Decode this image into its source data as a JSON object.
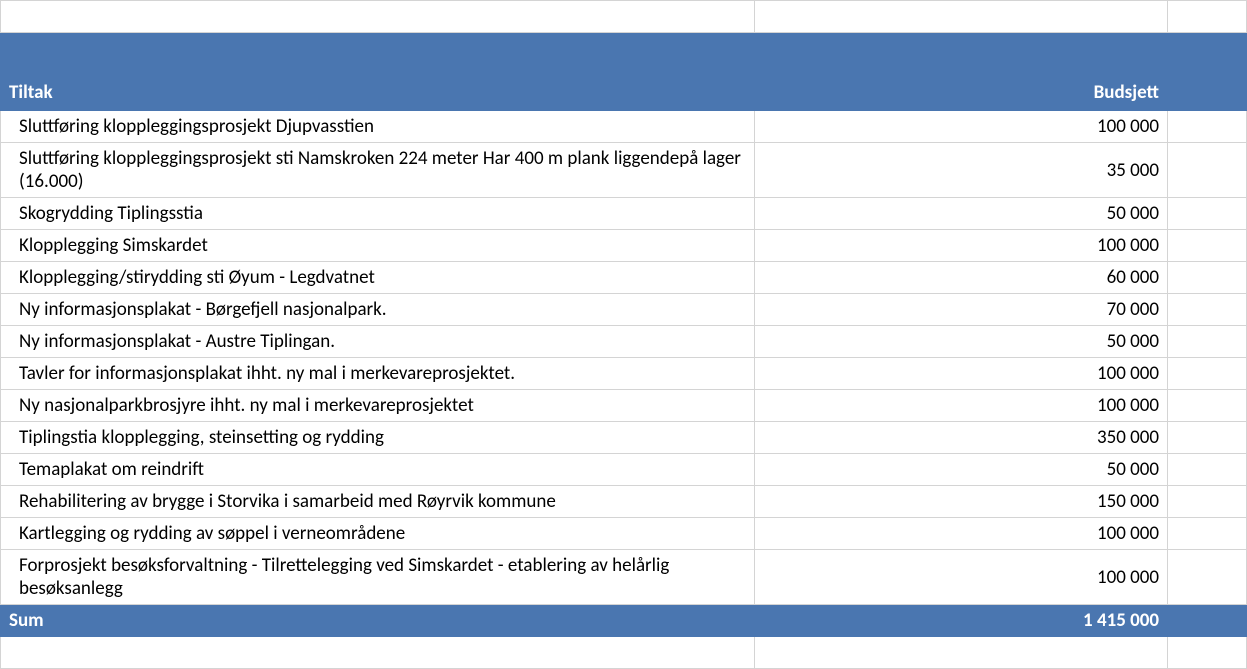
{
  "chart_data": {
    "type": "table",
    "title": "",
    "columns": [
      "Tiltak",
      "Budsjett"
    ],
    "rows": [
      [
        "Sluttføring kloppleggingsprosjekt Djupvasstien",
        100000
      ],
      [
        "Sluttføring kloppleggingsprosjekt sti Namskroken 224 meter Har 400 m plank liggendepå lager (16.000)",
        35000
      ],
      [
        "Skogrydding Tiplingsstia",
        50000
      ],
      [
        "Klopplegging Simskardet",
        100000
      ],
      [
        "Klopplegging/stirydding sti Øyum - Legdvatnet",
        60000
      ],
      [
        "Ny informasjonsplakat - Børgefjell nasjonalpark.",
        70000
      ],
      [
        "Ny informasjonsplakat - Austre Tiplingan.",
        50000
      ],
      [
        "Tavler for informasjonsplakat ihht. ny mal i merkevareprosjektet.",
        100000
      ],
      [
        "Ny nasjonalparkbrosjyre ihht. ny mal i merkevareprosjektet",
        100000
      ],
      [
        "Tiplingstia klopplegging, steinsetting og rydding",
        350000
      ],
      [
        "Temaplakat om reindrift",
        50000
      ],
      [
        "Rehabilitering av brygge i Storvika i samarbeid med Røyrvik kommune",
        150000
      ],
      [
        "Kartlegging og rydding av søppel i verneområdene",
        100000
      ],
      [
        "Forprosjekt besøksforvaltning - Tilrettelegging ved Simskardet - etablering av helårlig besøksanlegg",
        100000
      ]
    ],
    "sum": 1415000
  },
  "header": {
    "col1": "Tiltak",
    "col2": "Budsjett"
  },
  "rows": [
    {
      "tiltak": "Sluttføring kloppleggingsprosjekt Djupvasstien",
      "budsjett": "100 000"
    },
    {
      "tiltak": "Sluttføring kloppleggingsprosjekt sti Namskroken 224 meter Har 400 m plank liggendepå lager (16.000)",
      "budsjett": "35 000"
    },
    {
      "tiltak": "Skogrydding Tiplingsstia",
      "budsjett": "50 000"
    },
    {
      "tiltak": "Klopplegging Simskardet",
      "budsjett": "100 000"
    },
    {
      "tiltak": "Klopplegging/stirydding sti Øyum - Legdvatnet",
      "budsjett": "60 000"
    },
    {
      "tiltak": "Ny informasjonsplakat - Børgefjell nasjonalpark.",
      "budsjett": "70 000"
    },
    {
      "tiltak": "Ny informasjonsplakat - Austre Tiplingan.",
      "budsjett": "50 000"
    },
    {
      "tiltak": "Tavler for informasjonsplakat ihht. ny mal i merkevareprosjektet.",
      "budsjett": "100 000"
    },
    {
      "tiltak": "Ny nasjonalparkbrosjyre ihht. ny mal i merkevareprosjektet",
      "budsjett": "100 000"
    },
    {
      "tiltak": "Tiplingstia klopplegging, steinsetting og rydding",
      "budsjett": "350 000"
    },
    {
      "tiltak": "Temaplakat om reindrift",
      "budsjett": "50 000"
    },
    {
      "tiltak": "Rehabilitering av brygge i Storvika i samarbeid med Røyrvik kommune",
      "budsjett": "150 000"
    },
    {
      "tiltak": "Kartlegging og rydding av søppel i verneområdene",
      "budsjett": "100 000"
    },
    {
      "tiltak": "Forprosjekt besøksforvaltning - Tilrettelegging ved Simskardet - etablering av helårlig besøksanlegg",
      "budsjett": "100 000"
    }
  ],
  "sum": {
    "label": "Sum",
    "value": "1 415 000"
  }
}
